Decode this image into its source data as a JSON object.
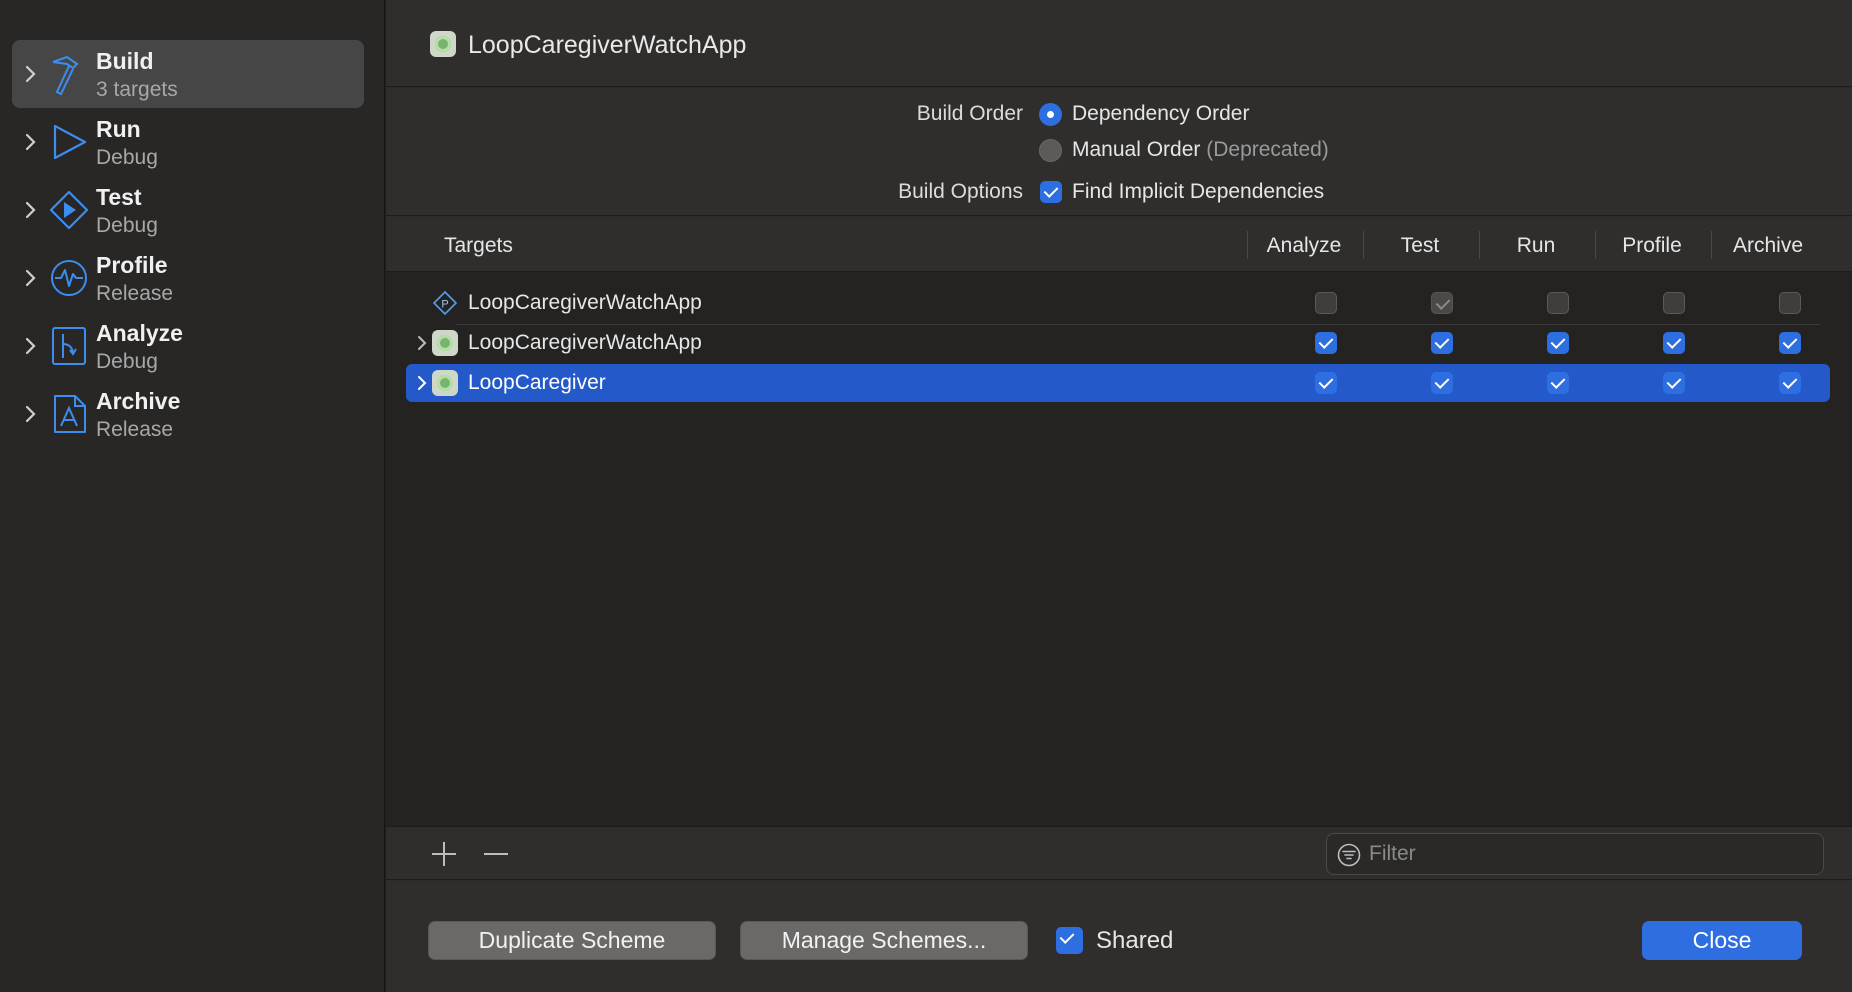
{
  "sidebar": {
    "items": [
      {
        "title": "Build",
        "subtitle": "3 targets",
        "icon": "hammer-icon",
        "selected": true
      },
      {
        "title": "Run",
        "subtitle": "Debug",
        "icon": "play-icon"
      },
      {
        "title": "Test",
        "subtitle": "Debug",
        "icon": "test-diamond-icon"
      },
      {
        "title": "Profile",
        "subtitle": "Release",
        "icon": "waveform-icon"
      },
      {
        "title": "Analyze",
        "subtitle": "Debug",
        "icon": "branch-icon"
      },
      {
        "title": "Archive",
        "subtitle": "Release",
        "icon": "archive-icon"
      }
    ]
  },
  "header": {
    "title": "LoopCaregiverWatchApp"
  },
  "options": {
    "build_order_label": "Build Order",
    "dependency_order": "Dependency Order",
    "manual_order": "Manual Order",
    "deprecated": "(Deprecated)",
    "build_options_label": "Build Options",
    "find_implicit": "Find Implicit Dependencies"
  },
  "table": {
    "columns": {
      "targets": "Targets",
      "analyze": "Analyze",
      "test": "Test",
      "run": "Run",
      "profile": "Profile",
      "archive": "Archive"
    },
    "rows": [
      {
        "name": "LoopCaregiverWatchApp",
        "icon": "package-icon",
        "checks": [
          "off",
          "disabled-on",
          "off",
          "off",
          "off"
        ]
      },
      {
        "name": "LoopCaregiverWatchApp",
        "icon": "app-icon",
        "checks": [
          "on",
          "on",
          "on",
          "on",
          "on"
        ]
      },
      {
        "name": "LoopCaregiver",
        "icon": "app-icon",
        "checks": [
          "on",
          "on",
          "on",
          "on",
          "on"
        ],
        "selected": true
      }
    ]
  },
  "footer": {
    "filter_placeholder": "Filter"
  },
  "bottom": {
    "duplicate": "Duplicate Scheme",
    "manage": "Manage Schemes...",
    "shared": "Shared",
    "close": "Close"
  },
  "colors": {
    "accent": "#2f6ee0",
    "selection": "#2359c8",
    "icon_blue": "#3b8ef0"
  }
}
